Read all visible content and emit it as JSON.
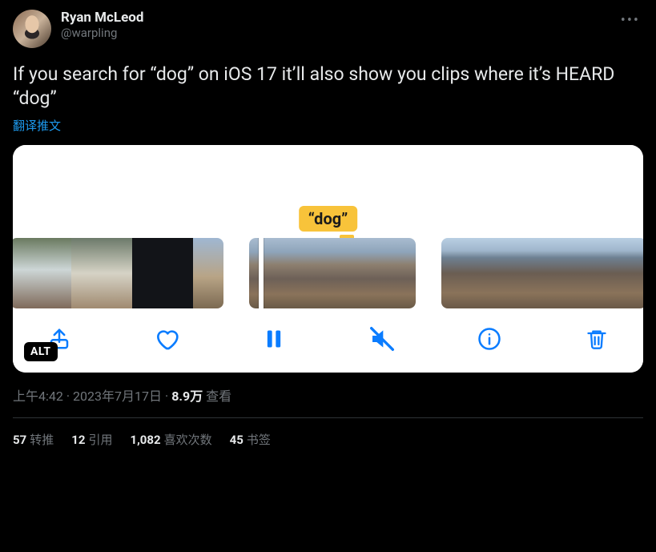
{
  "user": {
    "display_name": "Ryan McLeod",
    "handle": "@warpling"
  },
  "tweet": {
    "text": "If you search for “dog” on iOS 17 it’ll also show you clips where it’s HEARD “dog”",
    "translate_label": "翻译推文"
  },
  "media": {
    "badge_text": "“dog”",
    "alt_label": "ALT"
  },
  "meta": {
    "time": "上午4:42",
    "date": "2023年7月17日",
    "views_count": "8.9万",
    "views_label": "查看"
  },
  "stats": {
    "retweets": {
      "count": "57",
      "label": "转推"
    },
    "quotes": {
      "count": "12",
      "label": "引用"
    },
    "likes": {
      "count": "1,082",
      "label": "喜欢次数"
    },
    "bookmarks": {
      "count": "45",
      "label": "书签"
    }
  }
}
